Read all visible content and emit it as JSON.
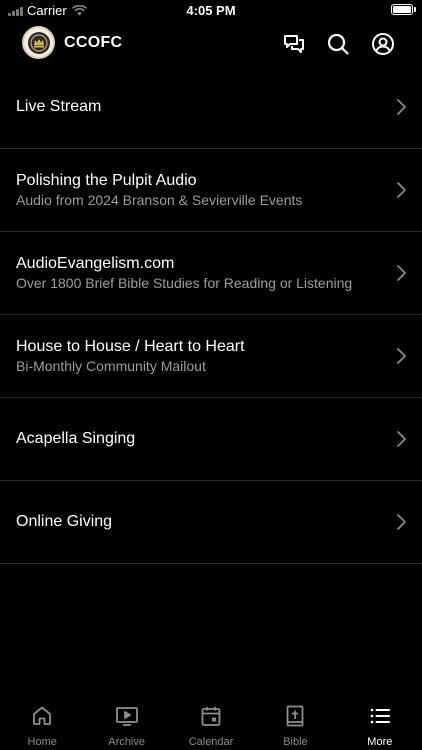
{
  "status_bar": {
    "carrier": "Carrier",
    "time": "4:05 PM",
    "battery_level": 1.0
  },
  "header": {
    "title": "CCOFC",
    "icons": [
      "chat-icon",
      "search-icon",
      "account-icon"
    ]
  },
  "menu": {
    "items": [
      {
        "title": "Live Stream",
        "subtitle": ""
      },
      {
        "title": "Polishing the Pulpit Audio",
        "subtitle": "Audio from 2024 Branson & Sevierville Events"
      },
      {
        "title": "AudioEvangelism.com",
        "subtitle": "Over 1800 Brief Bible Studies for Reading or Listening"
      },
      {
        "title": "House to House / Heart to Heart",
        "subtitle": "Bi-Monthly Community Mailout"
      },
      {
        "title": "Acapella Singing",
        "subtitle": ""
      },
      {
        "title": "Online Giving",
        "subtitle": ""
      }
    ]
  },
  "tab_bar": {
    "tabs": [
      {
        "label": "Home",
        "icon": "home-icon"
      },
      {
        "label": "Archive",
        "icon": "archive-icon"
      },
      {
        "label": "Calendar",
        "icon": "calendar-icon"
      },
      {
        "label": "Bible",
        "icon": "bible-icon"
      },
      {
        "label": "More",
        "icon": "list-icon"
      }
    ],
    "active": "More"
  },
  "colors": {
    "background": "#000000",
    "text_primary": "#ffffff",
    "text_secondary": "#9c9c9c",
    "separator": "#2b2b2b",
    "tab_inactive": "#8d8d8d"
  }
}
